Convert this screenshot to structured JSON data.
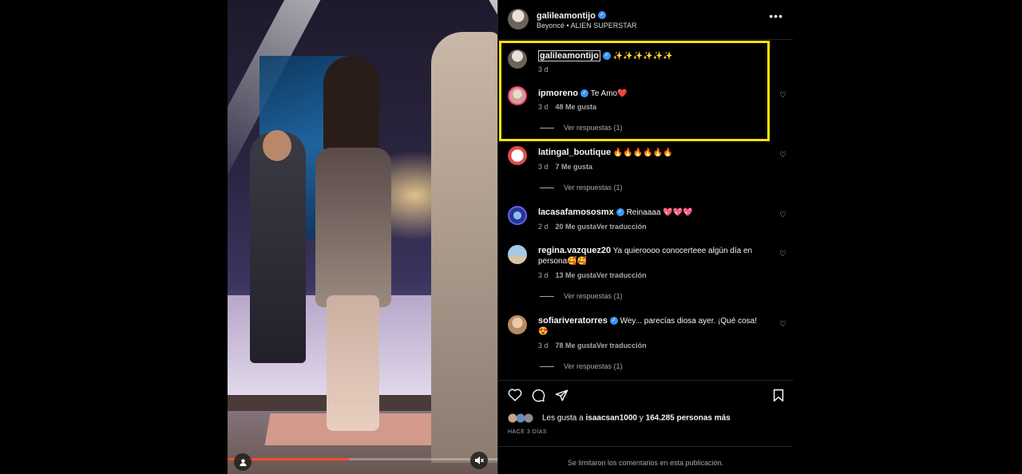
{
  "post": {
    "username": "galileamontijo",
    "audio": "Beyoncé • ALIEN SUPERSTAR",
    "more_label": "•••"
  },
  "comments": [
    {
      "user": "galileamontijo",
      "text": "✨✨✨✨✨✨",
      "time": "3 d",
      "likes": "",
      "translate": "",
      "replies": "",
      "verified": true
    },
    {
      "user": "ipmoreno",
      "text": "Te Amo❤️",
      "time": "3 d",
      "likes": "48 Me gusta",
      "translate": "",
      "replies": "Ver respuestas (1)",
      "verified": true
    },
    {
      "user": "latingal_boutique",
      "text": "🔥🔥🔥🔥🔥🔥",
      "time": "3 d",
      "likes": "7 Me gusta",
      "translate": "",
      "replies": "Ver respuestas (1)",
      "verified": false
    },
    {
      "user": "lacasafamososmx",
      "text": "Reinaaaa 💖💖💖",
      "time": "2 d",
      "likes": "20 Me gusta",
      "translate": "Ver traducción",
      "replies": "",
      "verified": true
    },
    {
      "user": "regina.vazquez20",
      "text": "Ya quieroooo conocerteee algún día en persona🥰🥰",
      "time": "3 d",
      "likes": "13 Me gusta",
      "translate": "Ver traducción",
      "replies": "Ver respuestas (1)",
      "verified": false
    },
    {
      "user": "sofiariveratorres",
      "text": "Wey... parecías diosa ayer. ¡Qué cosa! 😍",
      "time": "3 d",
      "likes": "78 Me gusta",
      "translate": "Ver traducción",
      "replies": "Ver respuestas (1)",
      "verified": true
    }
  ],
  "footer": {
    "likes_prefix": "Les gusta a ",
    "likes_user": "isaacsan1000",
    "likes_mid": " y ",
    "likes_count": "164.285 personas más",
    "ago": "HACE 3 DÍAS",
    "limited": "Se limitaron los comentarios en esta publicación."
  },
  "media": {
    "progress": 0.45
  },
  "colors": {
    "highlight": "#ffe400",
    "verified": "#3897f0",
    "progress": "#ff4a2a"
  },
  "icons": [
    "heart-icon",
    "comment-icon",
    "share-icon",
    "bookmark-icon",
    "user-tag-icon",
    "mute-icon",
    "verified-icon",
    "more-icon"
  ]
}
